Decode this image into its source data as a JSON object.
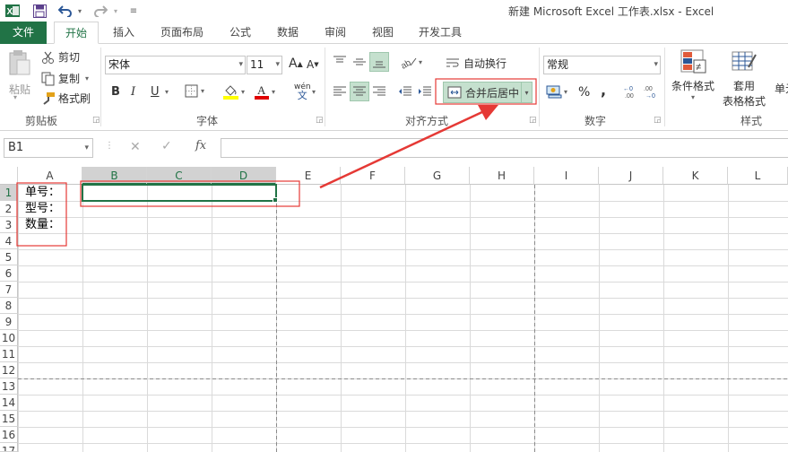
{
  "window": {
    "title": "新建 Microsoft Excel 工作表.xlsx - Excel",
    "accent_color": "#217346"
  },
  "tabs": [
    {
      "label": "文件"
    },
    {
      "label": "开始"
    },
    {
      "label": "插入"
    },
    {
      "label": "页面布局"
    },
    {
      "label": "公式"
    },
    {
      "label": "数据"
    },
    {
      "label": "审阅"
    },
    {
      "label": "视图"
    },
    {
      "label": "开发工具"
    }
  ],
  "clipboard": {
    "paste_label": "粘贴",
    "cut_label": "剪切",
    "copy_label": "复制",
    "format_painter_label": "格式刷",
    "group_label": "剪贴板"
  },
  "font": {
    "font_name": "宋体",
    "font_size": "11",
    "grow_label": "A",
    "shrink_label": "A",
    "bold_label": "B",
    "italic_label": "I",
    "underline_label": "U",
    "phonetic_label": "wén",
    "group_label": "字体"
  },
  "alignment": {
    "wrap_text_label": "自动换行",
    "merge_center_label": "合并后居中",
    "group_label": "对齐方式"
  },
  "number": {
    "format_value": "常规",
    "percent_label": "%",
    "comma_label": ",",
    "group_label": "数字"
  },
  "styles": {
    "conditional_format_label": "条件格式",
    "format_table_label_1": "套用",
    "format_table_label_2": "表格格式",
    "cell_styles_label": "单元",
    "group_label": "样式"
  },
  "formula_bar": {
    "name_box_value": "B1",
    "fx_label": "fx",
    "formula_value": ""
  },
  "sheet": {
    "columns": [
      "A",
      "B",
      "C",
      "D",
      "E",
      "F",
      "G",
      "H",
      "I",
      "J",
      "K",
      "L"
    ],
    "rows": [
      "1",
      "2",
      "3",
      "4",
      "5",
      "6",
      "7",
      "8",
      "9",
      "10",
      "11",
      "12",
      "13",
      "14",
      "15",
      "16",
      "17"
    ],
    "cells": {
      "A1": "单号：",
      "A2": "型号：",
      "A3": "数量："
    },
    "selected_range": "B1:D1"
  },
  "annotation_color": "#e53935"
}
